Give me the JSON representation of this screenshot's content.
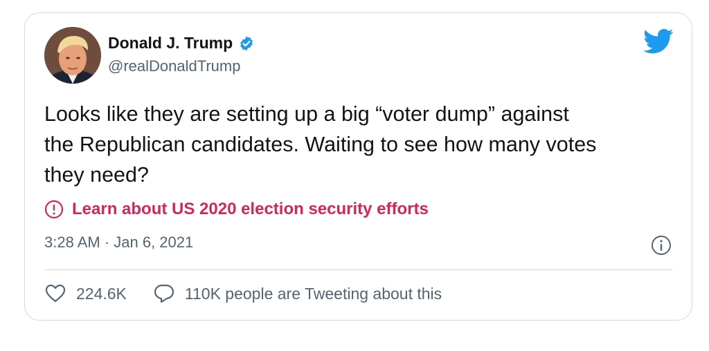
{
  "tweet": {
    "display_name": "Donald J. Trump",
    "handle": "@realDonaldTrump",
    "verified": true,
    "text": "Looks like they are setting up a big “voter dump” against\nthe Republican candidates. Waiting to see how many votes\nthey need?",
    "notice": "Learn about US 2020 election security efforts",
    "timestamp": "3:28 AM · Jan 6, 2021",
    "likes": "224.6K",
    "conversation": "110K people are Tweeting about this"
  },
  "icons": {
    "brand": "twitter-bird-icon",
    "verified": "verified-badge-icon",
    "notice": "exclamation-circle-icon",
    "info": "info-circle-icon",
    "like": "heart-icon",
    "reply": "speech-bubble-icon"
  },
  "colors": {
    "brand_blue": "#1d9bf0",
    "notice_pink": "#d6245c",
    "secondary_text": "#536471",
    "border": "#cfd9de"
  }
}
